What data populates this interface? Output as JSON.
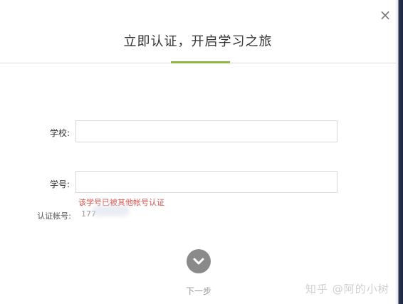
{
  "modal": {
    "title": "立即认证，开启学习之旅",
    "close_glyph": "×"
  },
  "form": {
    "school_label": "学校:",
    "school_value": "",
    "student_id_label": "学号:",
    "student_id_value": "",
    "error_message": "该学号已被其他帐号认证",
    "account_label": "认证帐号:",
    "account_value": "177"
  },
  "actions": {
    "next_label": "下一步",
    "next_icon": "chevron-down-icon"
  },
  "watermark": {
    "text": "知乎 @阿的小树"
  },
  "colors": {
    "accent": "#8cb83f",
    "error": "#d9534f",
    "next_button": "#8a8a8a"
  }
}
